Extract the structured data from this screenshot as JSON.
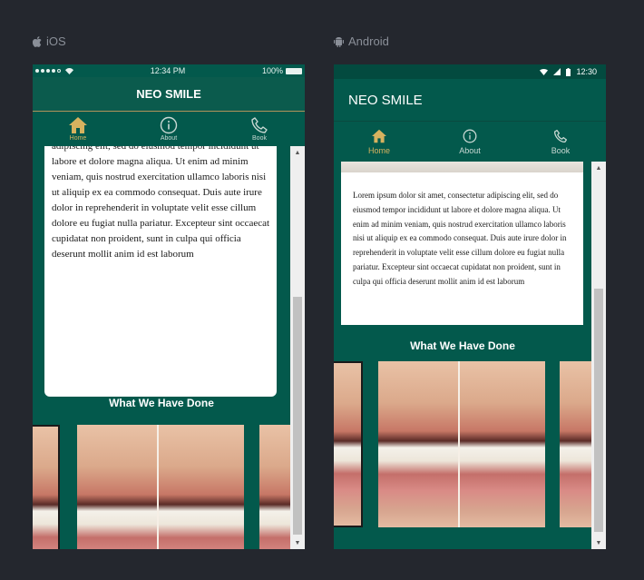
{
  "platforms": {
    "ios_label": "iOS",
    "android_label": "Android"
  },
  "ios": {
    "status": {
      "time": "12:34 PM",
      "battery": "100%"
    },
    "app_title": "NEO SMILE",
    "tabs": [
      {
        "label": "Home",
        "icon": "home-icon",
        "active": true
      },
      {
        "label": "About",
        "icon": "info-icon",
        "active": false
      },
      {
        "label": "Book",
        "icon": "phone-icon",
        "active": false
      }
    ],
    "body_text": "adipiscing elit, sed do eiusmod tempor incididunt ut labore et dolore magna aliqua. Ut enim ad minim veniam, quis nostrud exercitation ullamco laboris nisi ut aliquip ex ea commodo consequat. Duis aute irure dolor in reprehenderit in voluptate velit esse cillum dolore eu fugiat nulla pariatur. Excepteur sint occaecat cupidatat non proident, sunt in culpa qui officia deserunt mollit anim id est laborum",
    "section_title": "What We Have Done"
  },
  "android": {
    "status": {
      "time": "12:30"
    },
    "app_title": "NEO SMILE",
    "tabs": [
      {
        "label": "Home",
        "icon": "home-icon",
        "active": true
      },
      {
        "label": "About",
        "icon": "info-icon",
        "active": false
      },
      {
        "label": "Book",
        "icon": "phone-icon",
        "active": false
      }
    ],
    "body_text": "Lorem ipsum dolor sit amet, consectetur adipiscing elit, sed do eiusmod tempor incididunt ut labore et dolore magna aliqua. Ut enim ad minim veniam, quis nostrud exercitation ullamco laboris nisi ut aliquip ex ea commodo consequat. Duis aute irure dolor in reprehenderit in voluptate velit esse cillum dolore eu fugiat nulla pariatur. Excepteur sint occaecat cupidatat non proident, sunt in culpa qui officia deserunt mollit anim id est laborum",
    "section_title": "What We Have Done"
  },
  "colors": {
    "brand_green": "#03594c",
    "accent_gold": "#d6b25f",
    "page_bg": "#24272e"
  }
}
